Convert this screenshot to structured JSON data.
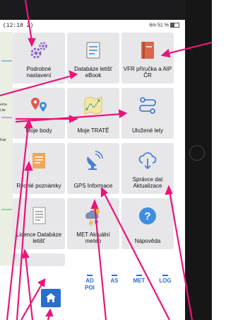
{
  "status": {
    "time": "(12:18 Z)",
    "right": "6m  51 %"
  },
  "tiles": [
    {
      "label": "Podrobné nastavení",
      "icon": "gear-icon"
    },
    {
      "label": "Databáze letišť eBook",
      "icon": "book-icon"
    },
    {
      "label": "VFR příručka a AIP ČR",
      "icon": "manual-book-icon"
    },
    {
      "label": "Moje body",
      "icon": "map-pin-icon"
    },
    {
      "label": "Moje TRATĚ",
      "icon": "route-map-icon"
    },
    {
      "label": "Uložené lety",
      "icon": "flight-path-icon"
    },
    {
      "label": "Rychlé poznámky",
      "icon": "notes-icon"
    },
    {
      "label": "GPS Informace",
      "icon": "satellite-dish-icon"
    },
    {
      "label": "Správce dat Aktualizace",
      "icon": "cloud-download-icon"
    },
    {
      "label": "Licence Databáze letišť",
      "icon": "document-list-icon"
    },
    {
      "label": "MET Aktuální meteo",
      "icon": "weather-icon"
    },
    {
      "label": "Nápověda",
      "icon": "help-icon"
    }
  ],
  "tabs": [
    {
      "label": "AD POI"
    },
    {
      "label": "AS"
    },
    {
      "label": "MET"
    },
    {
      "label": "LOG"
    }
  ],
  "map_labels": {
    "a": "ema",
    "b": "Lite",
    "c": "Kair"
  },
  "colors": {
    "accent": "#2a6fc9",
    "annotation": "#e8157a",
    "tile": "#e7e7e9"
  }
}
